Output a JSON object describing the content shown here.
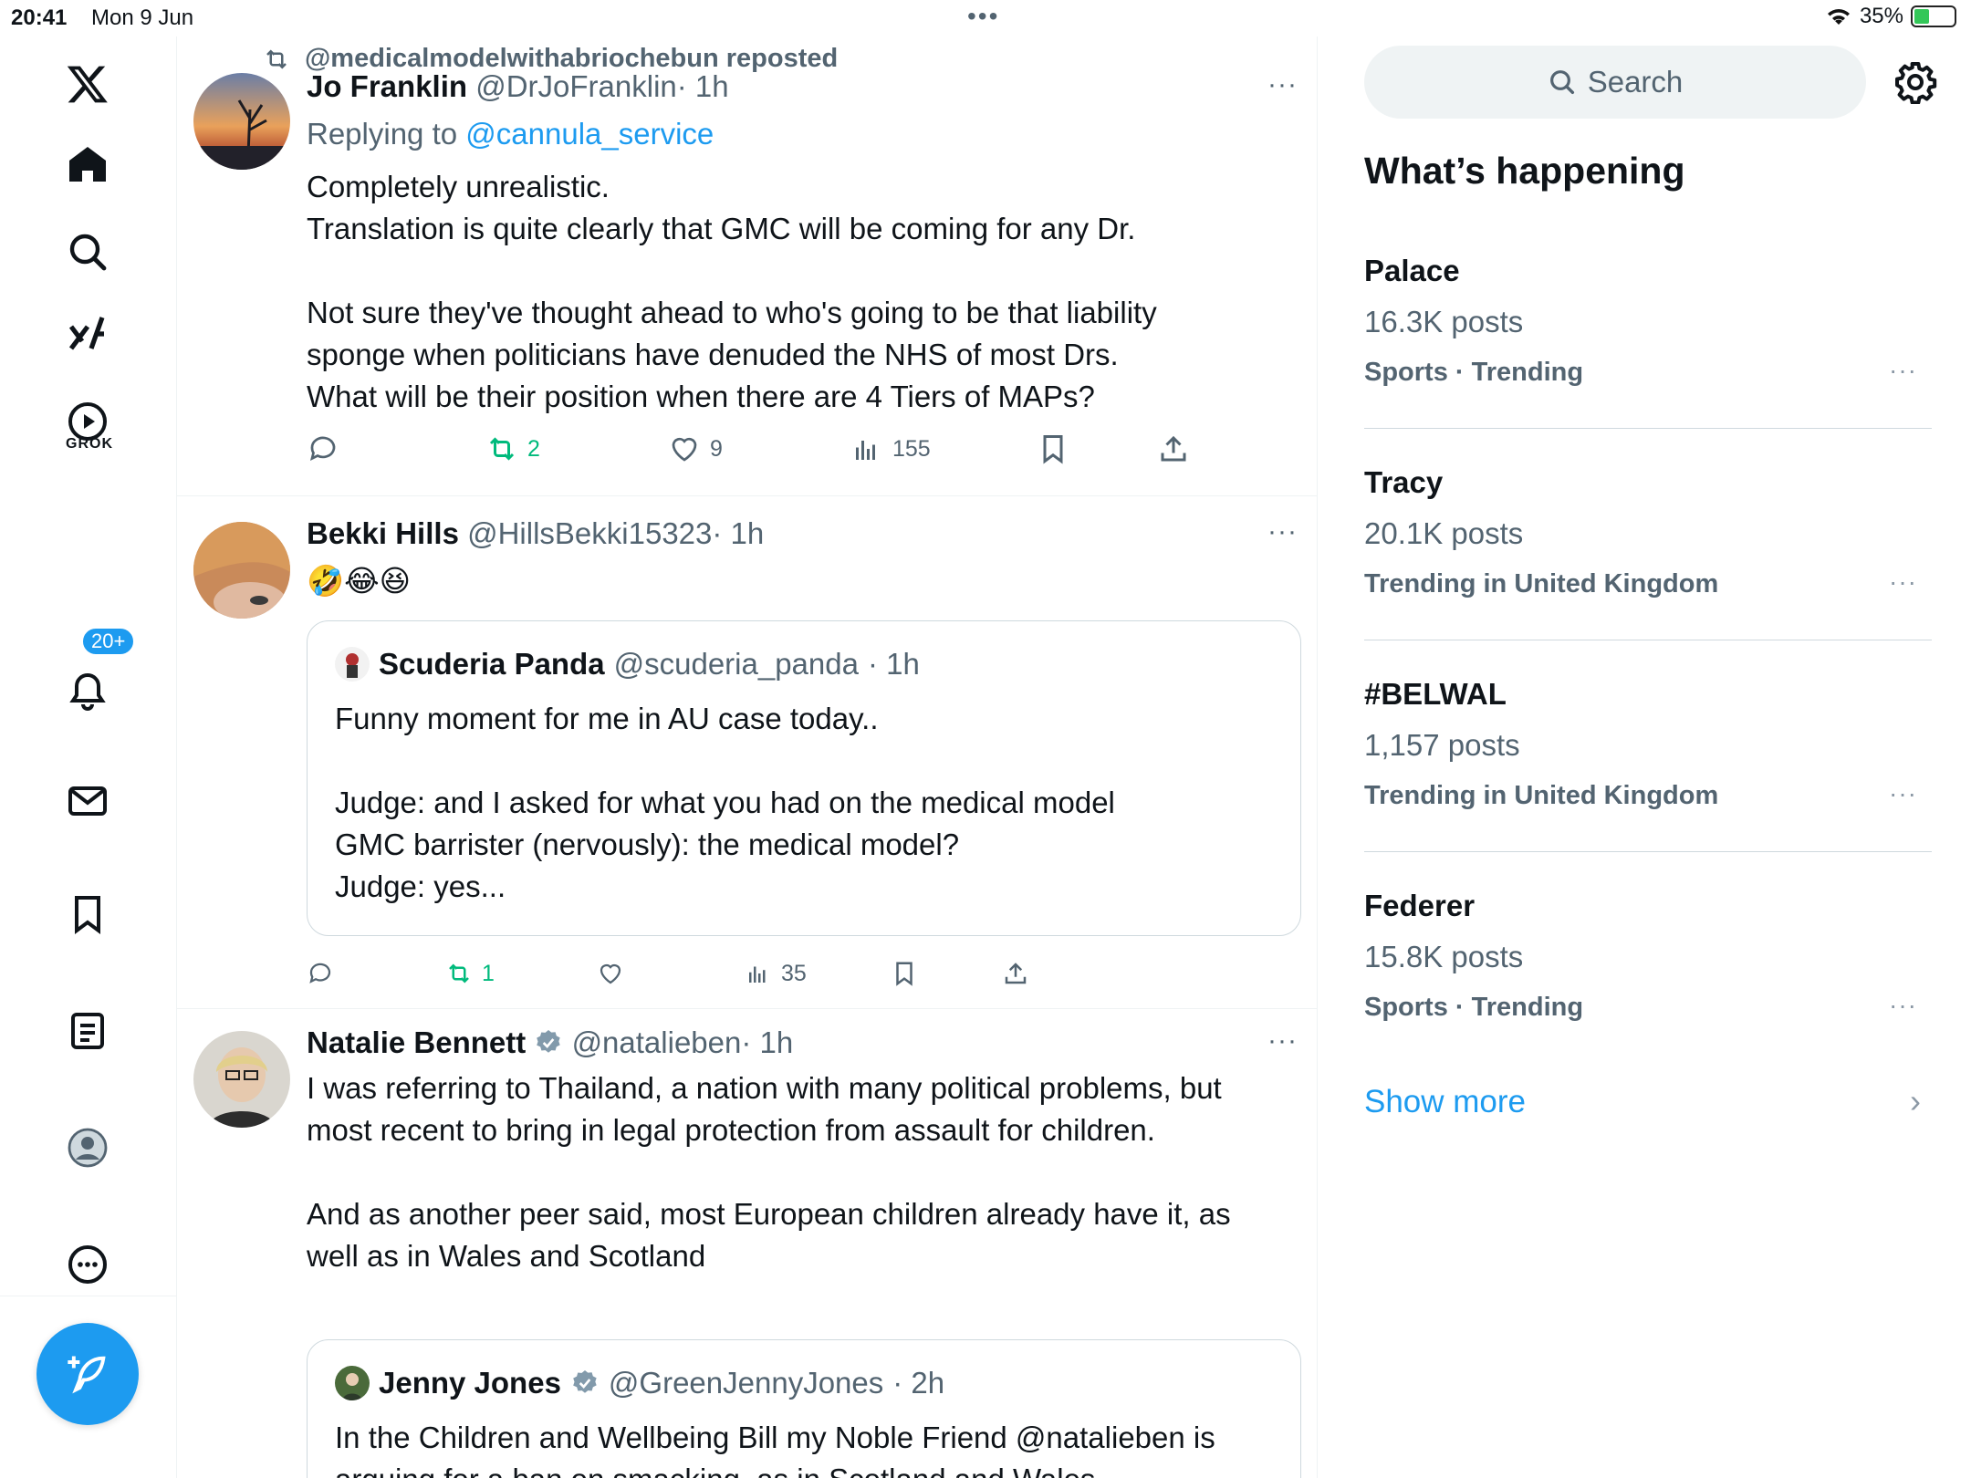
{
  "status_bar": {
    "time": "20:41",
    "date": "Mon 9 Jun",
    "battery": "35%"
  },
  "nav": {
    "grok_label": "GROK",
    "notifications_badge": "20+",
    "items": [
      "x-logo",
      "home-icon",
      "search-icon",
      "grok-icon",
      "video-icon",
      "bell-icon",
      "mail-icon",
      "bookmark-icon",
      "list-icon",
      "profile-icon",
      "more-icon"
    ]
  },
  "feed": {
    "post1": {
      "repost_text": "@medicalmodelwithabriochebun reposted",
      "name": "Jo Franklin",
      "handle": "@DrJoFranklin",
      "time": "· 1h",
      "replying_prefix": "Replying to",
      "replying_to": "@cannula_service",
      "line1": "Completely unrealistic.",
      "line2": "Translation is quite clearly that GMC will be coming for any Dr.",
      "line3": "Not sure they've thought ahead to who's going to be that liability",
      "line4": "sponge when politicians have denuded the NHS of most Drs.",
      "line5": "What will be their position when there are 4 Tiers of MAPs?",
      "reposts": "2",
      "likes": "9",
      "views": "155"
    },
    "post2": {
      "name": "Bekki Hills",
      "handle": "@HillsBekki15323",
      "time": "· 1h",
      "text": "🤣😂😆",
      "quote": {
        "name": "Scuderia Panda",
        "handle": "@scuderia_panda",
        "time": "· 1h",
        "line1": "Funny moment for me in AU case today..",
        "line2": "Judge: and I asked for what you had on the medical model",
        "line3": "GMC barrister (nervously): the medical model?",
        "line4": "Judge: yes..."
      },
      "reposts": "1",
      "views": "35"
    },
    "post3": {
      "name": "Natalie Bennett",
      "handle": "@natalieben",
      "time": "· 1h",
      "line1": "I was referring to Thailand, a nation with many political problems, but",
      "line2": "most recent to bring in legal protection from assault for children.",
      "line3": "And as another peer said, most European children already have it, as",
      "line4": "well as in Wales and Scotland",
      "quote": {
        "name": "Jenny Jones",
        "handle": "@GreenJennyJones",
        "time": "· 2h",
        "line1": "In the Children and Wellbeing Bill my Noble Friend @natalieben is",
        "line2": "arguing for a ban on smacking, as in Scotland and Wales."
      }
    }
  },
  "right": {
    "search_label": "Search",
    "section_title": "What’s happening",
    "trends": [
      {
        "name": "Palace",
        "posts": "16.3K posts",
        "context": "Sports · Trending"
      },
      {
        "name": "Tracy",
        "posts": "20.1K posts",
        "context": "Trending in United Kingdom"
      },
      {
        "name": "#BELWAL",
        "posts": "1,157 posts",
        "context": "Trending in United Kingdom"
      },
      {
        "name": "Federer",
        "posts": "15.8K posts",
        "context": "Sports · Trending"
      }
    ],
    "show_more": "Show more",
    "more_glyph": "···"
  },
  "colors": {
    "accent": "#1d9bf0",
    "repost_green": "#00ba7c",
    "muted": "#536471"
  }
}
